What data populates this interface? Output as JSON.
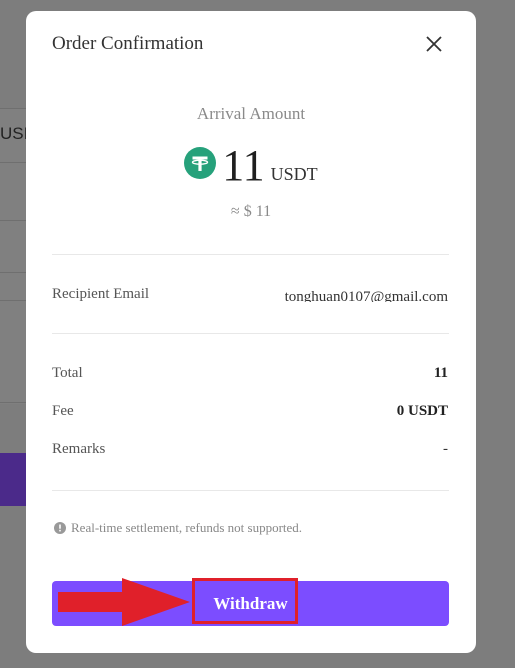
{
  "background": {
    "partial_label": "USI"
  },
  "dialog": {
    "title": "Order Confirmation",
    "close_icon": "close-icon",
    "arrival_label": "Arrival Amount",
    "amount": "11",
    "currency": "USDT",
    "coin_icon": "tether-icon",
    "approx": "≈ $ 11",
    "recipient_label": "Recipient Email",
    "recipient_value": "tonghuan0107@gmail.com",
    "total_label": "Total",
    "total_value": "11",
    "fee_label": "Fee",
    "fee_value": "0 USDT",
    "remarks_label": "Remarks",
    "remarks_value": "-",
    "notice": "Real-time settlement, refunds not supported.",
    "notice_icon": "info-icon",
    "withdraw_label": "Withdraw"
  },
  "annotation": {
    "arrow_icon": "red-arrow-icon",
    "highlight_color": "#e0202a"
  },
  "colors": {
    "accent": "#7c4dff",
    "tether": "#26a17b"
  }
}
